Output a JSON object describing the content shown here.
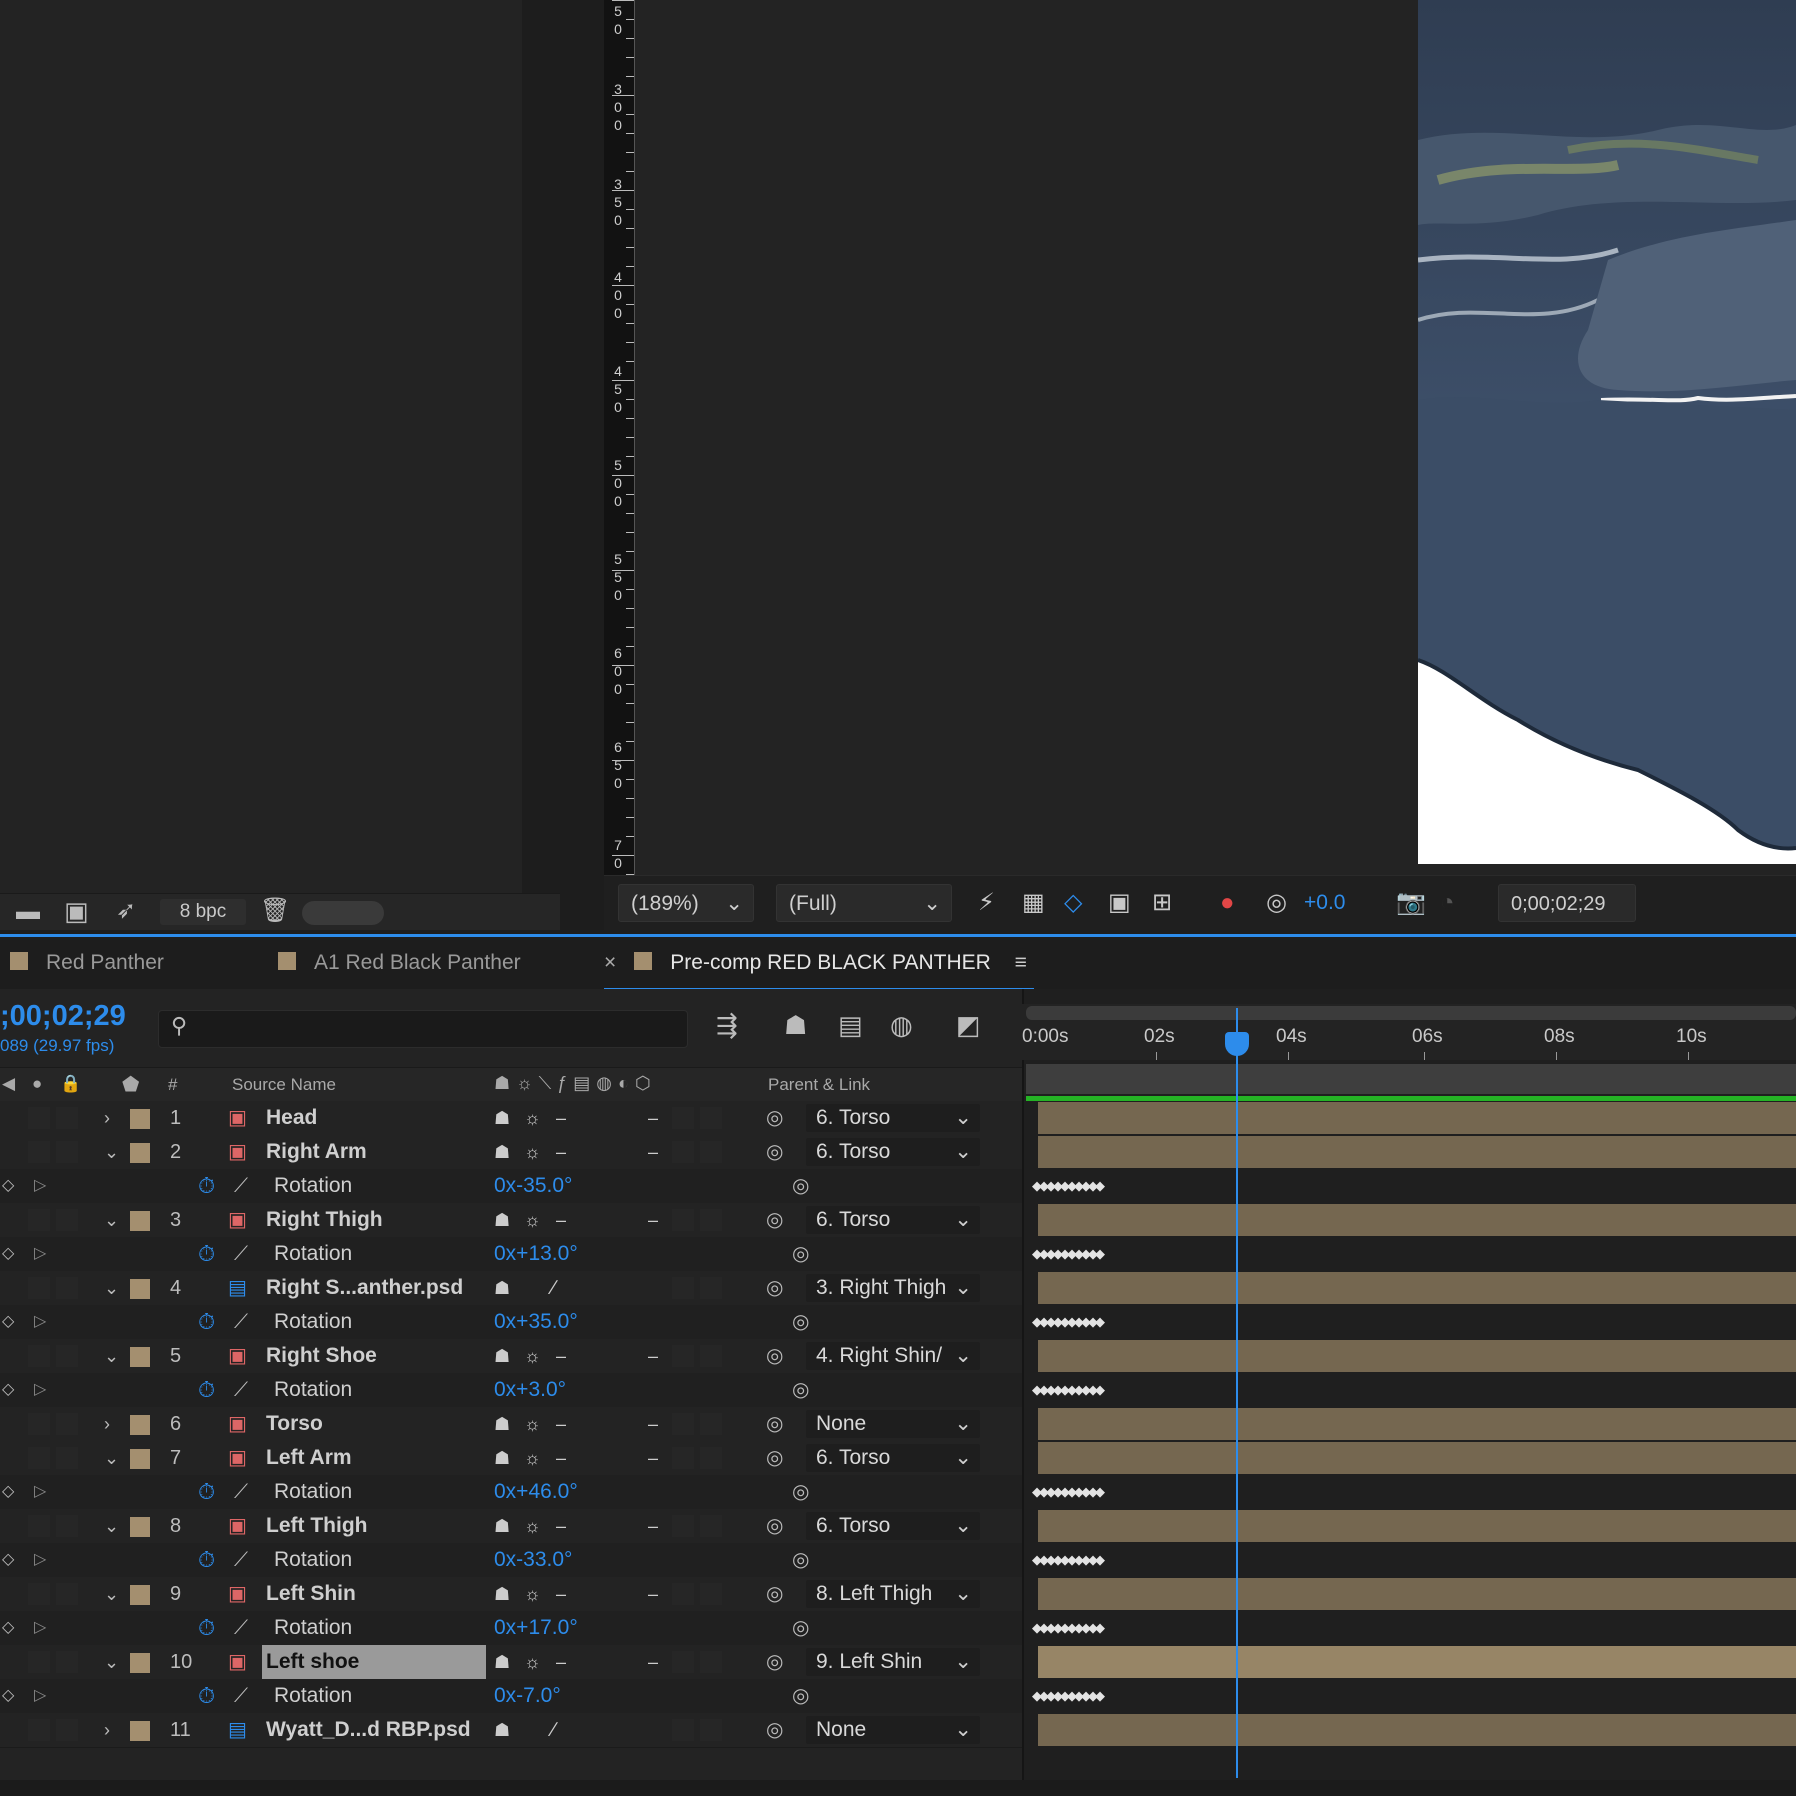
{
  "project_panel": {
    "bpc": "8 bpc"
  },
  "ruler_labels": [
    {
      "digits": [
        "5",
        "0"
      ]
    },
    {
      "digits": [
        "3",
        "0",
        "0"
      ]
    },
    {
      "digits": [
        "3",
        "5",
        "0"
      ]
    },
    {
      "digits": [
        "4",
        "0",
        "0"
      ]
    },
    {
      "digits": [
        "4",
        "5",
        "0"
      ]
    },
    {
      "digits": [
        "5",
        "0",
        "0"
      ]
    },
    {
      "digits": [
        "5",
        "5",
        "0"
      ]
    },
    {
      "digits": [
        "6",
        "0",
        "0"
      ]
    },
    {
      "digits": [
        "6",
        "5",
        "0"
      ]
    },
    {
      "digits": [
        "7",
        "0"
      ]
    }
  ],
  "viewer_bar": {
    "zoom": "(189%)",
    "resolution": "(Full)",
    "exposure": "+0.0",
    "timecode": "0;00;02;29"
  },
  "tabs": [
    {
      "label": "Red Panther"
    },
    {
      "label": "A1 Red Black Panther"
    },
    {
      "label": "Pre-comp RED BLACK PANTHER",
      "close": "×",
      "menu": "≡"
    }
  ],
  "timeline": {
    "current_time": ";00;02;29",
    "frame_info": "089 (29.97 fps)",
    "headers": {
      "hash": "#",
      "source_name": "Source Name",
      "parent": "Parent & Link"
    },
    "time_labels": [
      "0:00s",
      "02s",
      "04s",
      "06s",
      "08s",
      "10s"
    ],
    "rows": [
      {
        "type": "layer",
        "num": "1",
        "name": "Head",
        "parent": "6. Torso",
        "expanded": false
      },
      {
        "type": "layer",
        "num": "2",
        "name": "Right Arm",
        "parent": "6. Torso",
        "expanded": true
      },
      {
        "type": "prop",
        "label": "Rotation",
        "value": "0x-35.0°"
      },
      {
        "type": "layer",
        "num": "3",
        "name": "Right Thigh",
        "parent": "6. Torso",
        "expanded": true
      },
      {
        "type": "prop",
        "label": "Rotation",
        "value": "0x+13.0°"
      },
      {
        "type": "layer",
        "num": "4",
        "name": "Right S...anther.psd",
        "parent": "3. Right Thigh",
        "expanded": true,
        "psd": true
      },
      {
        "type": "prop",
        "label": "Rotation",
        "value": "0x+35.0°"
      },
      {
        "type": "layer",
        "num": "5",
        "name": "Right Shoe",
        "parent": "4. Right Shin/",
        "expanded": true
      },
      {
        "type": "prop",
        "label": "Rotation",
        "value": "0x+3.0°"
      },
      {
        "type": "layer",
        "num": "6",
        "name": "Torso",
        "parent": "None",
        "expanded": false
      },
      {
        "type": "layer",
        "num": "7",
        "name": "Left Arm",
        "parent": "6. Torso",
        "expanded": true
      },
      {
        "type": "prop",
        "label": "Rotation",
        "value": "0x+46.0°"
      },
      {
        "type": "layer",
        "num": "8",
        "name": "Left Thigh",
        "parent": "6. Torso",
        "expanded": true
      },
      {
        "type": "prop",
        "label": "Rotation",
        "value": "0x-33.0°"
      },
      {
        "type": "layer",
        "num": "9",
        "name": "Left Shin",
        "parent": "8. Left Thigh",
        "expanded": true
      },
      {
        "type": "prop",
        "label": "Rotation",
        "value": "0x+17.0°"
      },
      {
        "type": "layer",
        "num": "10",
        "name": "Left shoe",
        "parent": "9. Left Shin",
        "expanded": true,
        "selected": true
      },
      {
        "type": "prop",
        "label": "Rotation",
        "value": "0x-7.0°"
      },
      {
        "type": "layer",
        "num": "11",
        "name": "Wyatt_D...d RBP.psd",
        "parent": "None",
        "expanded": false,
        "psd": true
      }
    ]
  },
  "colors": {
    "accent": "#2d8ceb",
    "label_tan": "#a48f6f",
    "bar": "#756750",
    "green": "#25b325"
  }
}
